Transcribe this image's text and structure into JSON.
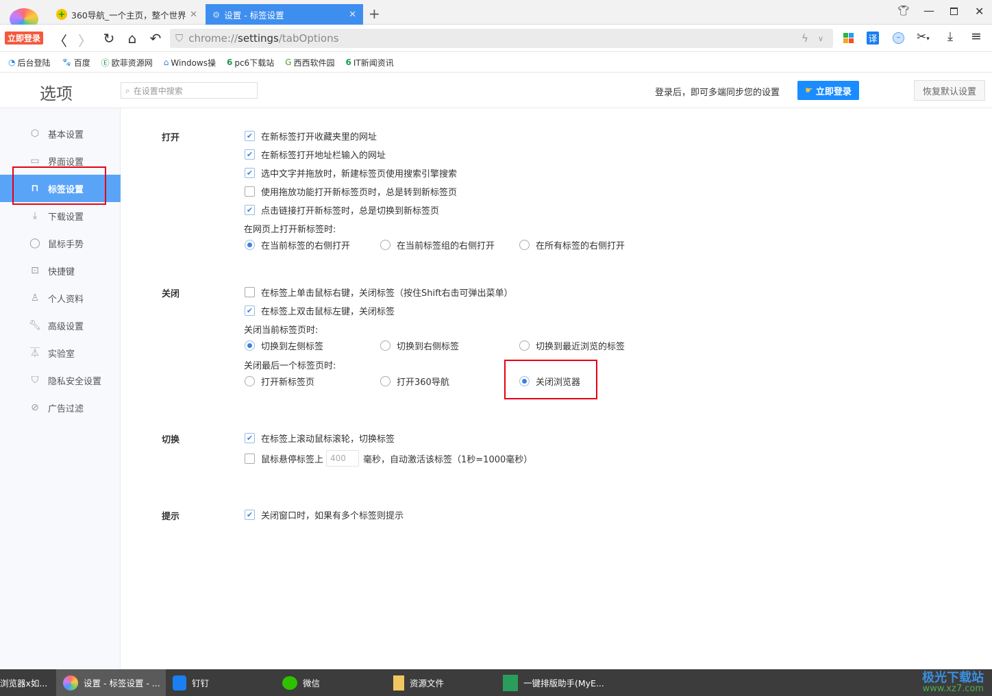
{
  "browser": {
    "login_badge": "立即登录",
    "tabs": [
      {
        "title": "360导航_一个主页，整个世界",
        "active": false
      },
      {
        "title": "设置 - 标签设置",
        "active": true
      }
    ],
    "url_prefix": "chrome://",
    "url_main": "settings",
    "url_suffix": "/tabOptions",
    "bookmarks": [
      "后台登陆",
      "百度",
      "欧菲资源网",
      "Windows操",
      "pc6下载站",
      "西西软件园",
      "IT新闻资讯"
    ],
    "translate_label": "译"
  },
  "header": {
    "title": "选项",
    "search_placeholder": "在设置中搜索",
    "sync_text": "登录后，即可多端同步您的设置",
    "login_button": "立即登录",
    "reset_button": "恢复默认设置"
  },
  "sidebar": {
    "items": [
      {
        "label": "基本设置",
        "icon": "gear-icon"
      },
      {
        "label": "界面设置",
        "icon": "window-icon"
      },
      {
        "label": "标签设置",
        "icon": "tab-icon",
        "active": true
      },
      {
        "label": "下载设置",
        "icon": "download-icon"
      },
      {
        "label": "鼠标手势",
        "icon": "mouse-icon"
      },
      {
        "label": "快捷键",
        "icon": "keyboard-icon"
      },
      {
        "label": "个人资料",
        "icon": "user-icon"
      },
      {
        "label": "高级设置",
        "icon": "wrench-icon"
      },
      {
        "label": "实验室",
        "icon": "flask-icon"
      },
      {
        "label": "隐私安全设置",
        "icon": "shield-icon"
      },
      {
        "label": "广告过滤",
        "icon": "block-icon"
      }
    ]
  },
  "sections": {
    "open": {
      "label": "打开",
      "options": [
        {
          "label": "在新标签打开收藏夹里的网址",
          "checked": true
        },
        {
          "label": "在新标签打开地址栏输入的网址",
          "checked": true
        },
        {
          "label": "选中文字并拖放时，新建标签页使用搜索引擎搜索",
          "checked": true
        },
        {
          "label": "使用拖放功能打开新标签页时，总是转到新标签页",
          "checked": false
        },
        {
          "label": "点击链接打开新标签时，总是切换到新标签页",
          "checked": true
        }
      ],
      "position_label": "在网页上打开新标签时:",
      "position_options": [
        "在当前标签的右侧打开",
        "在当前标签组的右侧打开",
        "在所有标签的右侧打开"
      ],
      "position_selected": 0
    },
    "close": {
      "label": "关闭",
      "options": [
        {
          "label": "在标签上单击鼠标右键，关闭标签（按住Shift右击可弹出菜单）",
          "checked": false
        },
        {
          "label": "在标签上双击鼠标左键，关闭标签",
          "checked": true
        }
      ],
      "current_label": "关闭当前标签页时:",
      "current_options": [
        "切换到左侧标签",
        "切换到右侧标签",
        "切换到最近浏览的标签"
      ],
      "current_selected": 0,
      "last_label": "关闭最后一个标签页时:",
      "last_options": [
        "打开新标签页",
        "打开360导航",
        "关闭浏览器"
      ],
      "last_selected": 2
    },
    "switch": {
      "label": "切换",
      "options": [
        {
          "label": "在标签上滚动鼠标滚轮，切换标签",
          "checked": true
        }
      ],
      "hover_label": "鼠标悬停标签上",
      "hover_checked": false,
      "hover_value": "400",
      "hover_suffix": "毫秒，自动激活该标签（1秒=1000毫秒）"
    },
    "hint": {
      "label": "提示",
      "options": [
        {
          "label": "关闭窗口时，如果有多个标签则提示",
          "checked": true
        }
      ]
    }
  },
  "taskbar": {
    "items": [
      "浏览器x如...",
      "设置 - 标签设置 - ...",
      "钉钉",
      "微信",
      "资源文件",
      "一键排版助手(MyE..."
    ],
    "watermark": "极光下载站",
    "watermark_url": "www.xz7.com"
  },
  "colors": {
    "accent": "#5aa4f7",
    "highlight_box": "#e60012",
    "login_button": "#1a8cff"
  }
}
